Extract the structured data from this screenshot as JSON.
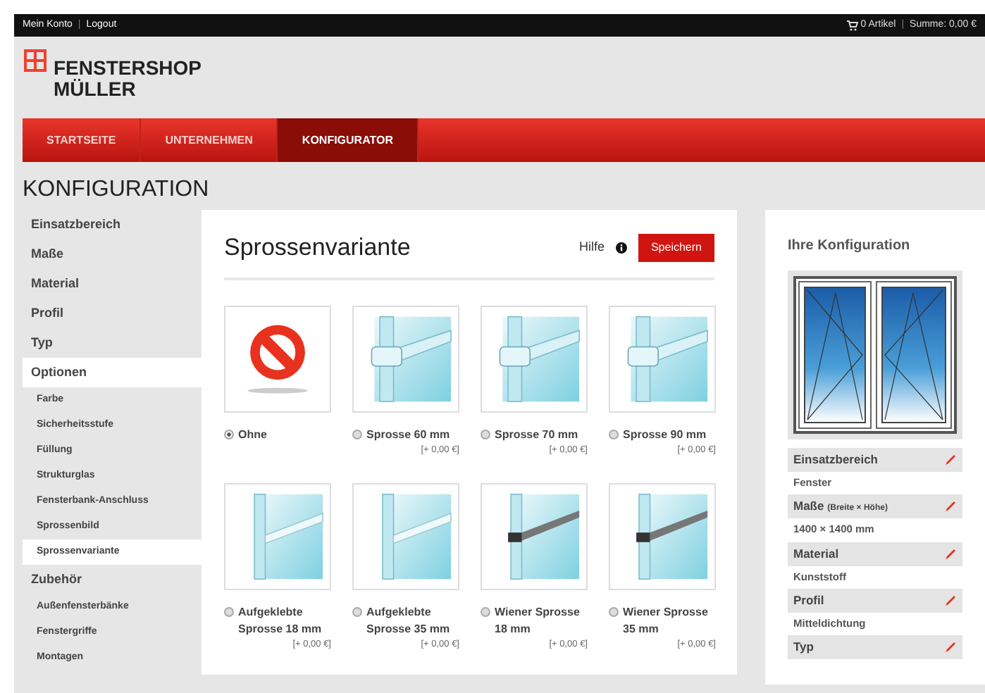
{
  "topbar": {
    "links": [
      "Mein Konto",
      "Logout"
    ],
    "separator": "|",
    "cart": "0 Artikel",
    "sum": "Summe: 0,00 €"
  },
  "logo": {
    "line1": "FENSTERSHOP",
    "line2": "MÜLLER"
  },
  "nav": [
    {
      "label": "STARTSEITE",
      "selected": false
    },
    {
      "label": "UNTERNEHMEN",
      "selected": false
    },
    {
      "label": "KONFIGURATOR",
      "selected": true
    }
  ],
  "page_title": "KONFIGURATION",
  "sidebar": [
    {
      "label": "Einsatzbereich",
      "selected": false
    },
    {
      "label": "Maße",
      "selected": false
    },
    {
      "label": "Material",
      "selected": false
    },
    {
      "label": "Profil",
      "selected": false
    },
    {
      "label": "Typ",
      "selected": false
    },
    {
      "label": "Optionen",
      "selected": true,
      "children": [
        {
          "label": "Farbe",
          "selected": false
        },
        {
          "label": "Sicherheitsstufe",
          "selected": false
        },
        {
          "label": "Füllung",
          "selected": false
        },
        {
          "label": "Strukturglas",
          "selected": false
        },
        {
          "label": "Fensterbank-Anschluss",
          "selected": false
        },
        {
          "label": "Sprossenbild",
          "selected": false
        },
        {
          "label": "Sprossenvariante",
          "selected": true
        }
      ]
    },
    {
      "label": "Zubehör",
      "selected": false,
      "children": [
        {
          "label": "Außenfensterbänke",
          "selected": false
        },
        {
          "label": "Fenstergriffe",
          "selected": false
        },
        {
          "label": "Montagen",
          "selected": false
        }
      ]
    }
  ],
  "main": {
    "title": "Sprossenvariante",
    "help": "Hilfe",
    "save": "Speichern",
    "options": [
      {
        "kind": "none",
        "label": "Ohne",
        "selected": true
      },
      {
        "kind": "clamp",
        "label": "Sprosse 60 mm",
        "price": "[+ 0,00 €]",
        "selected": false
      },
      {
        "kind": "clamp",
        "label": "Sprosse 70 mm",
        "price": "[+ 0,00 €]",
        "selected": false
      },
      {
        "kind": "clamp",
        "label": "Sprosse 90 mm",
        "price": "[+ 0,00 €]",
        "selected": false
      },
      {
        "kind": "glued",
        "label": "Aufgeklebte Sprosse 18 mm",
        "price": "[+ 0,00 €]",
        "selected": false
      },
      {
        "kind": "glued",
        "label": "Aufgeklebte Sprosse 35 mm",
        "price": "[+ 0,00 €]",
        "selected": false
      },
      {
        "kind": "wiener",
        "label": "Wiener Sprosse 18 mm",
        "price": "[+ 0,00 €]",
        "selected": false
      },
      {
        "kind": "wiener",
        "label": "Wiener Sprosse 35 mm",
        "price": "[+ 0,00 €]",
        "selected": false
      }
    ]
  },
  "summary": {
    "title": "Ihre Konfiguration",
    "items": [
      {
        "label": "Einsatzbereich",
        "value": "Fenster"
      },
      {
        "label": "Maße",
        "hint": "(Breite × Höhe)",
        "value": "1400 × 1400 mm"
      },
      {
        "label": "Material",
        "value": "Kunststoff"
      },
      {
        "label": "Profil",
        "value": "Mitteldichtung"
      },
      {
        "label": "Typ"
      }
    ]
  }
}
